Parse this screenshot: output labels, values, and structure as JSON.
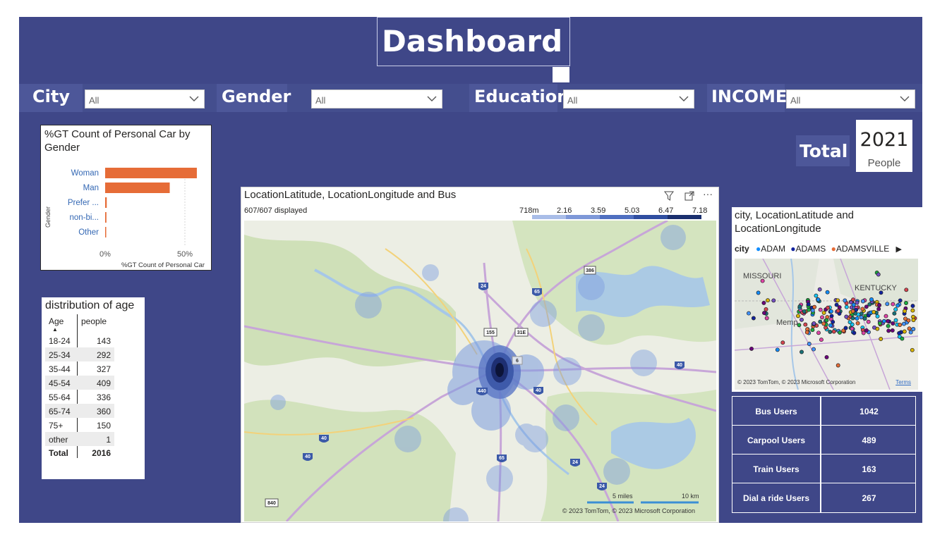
{
  "title": "Dashboard",
  "slicers": [
    {
      "label": "City",
      "value": "All"
    },
    {
      "label": "Gender",
      "value": "All"
    },
    {
      "label": "Education",
      "value": "All"
    },
    {
      "label": "INCOME",
      "value": "All"
    }
  ],
  "total": {
    "label": "Total",
    "value": "2021",
    "caption": "People"
  },
  "bar_chart": {
    "title": "%GT Count of Personal Car by Gender",
    "ylabel": "Gender",
    "xlabel": "%GT Count of Personal Car",
    "tick_labels": [
      "0%",
      "50%"
    ],
    "bar_color": "#e66c37"
  },
  "age_table": {
    "title": "distribution of age",
    "headers": [
      "Age",
      "people"
    ],
    "rows": [
      {
        "age": "18-24",
        "people": "143"
      },
      {
        "age": "25-34",
        "people": "292"
      },
      {
        "age": "35-44",
        "people": "327"
      },
      {
        "age": "45-54",
        "people": "409"
      },
      {
        "age": "55-64",
        "people": "336"
      },
      {
        "age": "65-74",
        "people": "360"
      },
      {
        "age": "75+",
        "people": "150"
      },
      {
        "age": "other",
        "people": "1"
      }
    ],
    "total_label": "Total",
    "total_value": "2016"
  },
  "map": {
    "title": "LocationLatitude, LocationLongitude and Bus",
    "subtitle": "607/607 displayed",
    "legend": [
      "718m",
      "2.16",
      "3.59",
      "5.03",
      "6.47",
      "7.18"
    ],
    "legend_colors": [
      "#a9bde8",
      "#7e98d8",
      "#4f6fc0",
      "#2f4ea0",
      "#1a2f6e"
    ],
    "scale_labels": [
      "5 miles",
      "10 km"
    ],
    "copyright": "© 2023 TomTom, © 2023 Microsoft Corporation",
    "road_labels": [
      "386",
      "24",
      "65",
      "155",
      "31E",
      "6",
      "440",
      "40",
      "40",
      "40",
      "24",
      "24",
      "40",
      "65",
      "840"
    ]
  },
  "city_map": {
    "title": "city, LocationLatitude and LocationLongitude",
    "legend_title": "city",
    "legend": [
      {
        "name": "ADAM",
        "color": "#118dff"
      },
      {
        "name": "ADAMS",
        "color": "#12239e"
      },
      {
        "name": "ADAMSVILLE",
        "color": "#e66c37"
      }
    ],
    "place_labels": [
      "MISSOURI",
      "KENTUCKY",
      "Memp"
    ],
    "copyright": "© 2023 TomTom, © 2023 Microsoft Corporation",
    "terms": "Terms"
  },
  "users": [
    {
      "label": "Bus  Users",
      "value": "1042"
    },
    {
      "label": "Carpool  Users",
      "value": "489"
    },
    {
      "label": "Train Users",
      "value": "163"
    },
    {
      "label": "Dial a ride Users",
      "value": "267"
    }
  ],
  "chart_data": {
    "type": "bar",
    "orientation": "horizontal",
    "title": "%GT Count of Personal Car by Gender",
    "categories": [
      "Woman",
      "Man",
      "Prefer ...",
      "non-bi...",
      "Other"
    ],
    "values": [
      57.5,
      40.5,
      1.0,
      0.8,
      0.3
    ],
    "xlabel": "%GT Count of Personal Car",
    "ylabel": "Gender",
    "xlim": [
      0,
      70
    ],
    "unit": "%"
  }
}
